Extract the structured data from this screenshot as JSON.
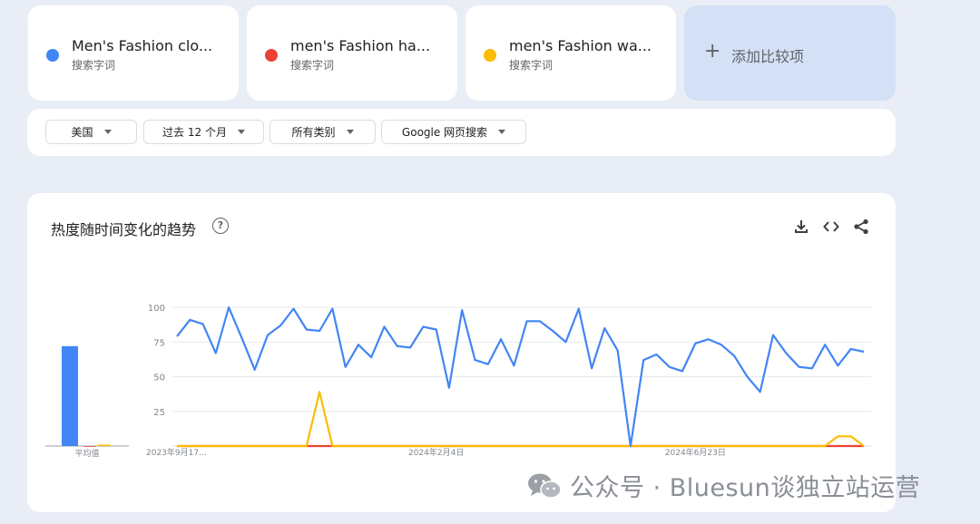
{
  "terms": [
    {
      "title": "Men's Fashion clo...",
      "subtitle": "搜索字词",
      "color": "#4285f4"
    },
    {
      "title": "men's Fashion ha...",
      "subtitle": "搜索字词",
      "color": "#ea4335"
    },
    {
      "title": "men's Fashion wa...",
      "subtitle": "搜索字词",
      "color": "#fbbc04"
    }
  ],
  "add_compare": {
    "icon": "+",
    "label": "添加比较项"
  },
  "filters": [
    {
      "label": "美国"
    },
    {
      "label": "过去 12 个月"
    },
    {
      "label": "所有类别"
    },
    {
      "label": "Google 网页搜索"
    }
  ],
  "chart_section": {
    "title": "热度随时间变化的趋势",
    "help_icon": "?",
    "tools": [
      "download-icon",
      "embed-icon",
      "share-icon"
    ]
  },
  "chart_data": {
    "type": "line",
    "ylim": [
      0,
      100
    ],
    "y_ticks": [
      100,
      75,
      50,
      25
    ],
    "x_tick_labels": [
      "2023年9月17...",
      "2024年2月4日",
      "2024年6月23日"
    ],
    "x_tick_index": [
      0,
      20,
      40
    ],
    "series": [
      {
        "name": "Men's Fashion clo...",
        "color": "#4285f4",
        "values": [
          79,
          91,
          88,
          67,
          100,
          78,
          55,
          80,
          87,
          99,
          84,
          83,
          99,
          57,
          73,
          64,
          86,
          72,
          71,
          86,
          84,
          42,
          98,
          62,
          59,
          77,
          58,
          90,
          90,
          83,
          75,
          99,
          56,
          85,
          69,
          0,
          62,
          66,
          57,
          54,
          74,
          77,
          73,
          65,
          50,
          39,
          80,
          67,
          57,
          56,
          73,
          58,
          70,
          68
        ]
      },
      {
        "name": "men's Fashion ha...",
        "color": "#ea4335",
        "values": [
          0,
          0,
          0,
          0,
          0,
          0,
          0,
          0,
          0,
          0,
          0,
          0,
          0,
          0,
          0,
          0,
          0,
          0,
          0,
          0,
          0,
          0,
          0,
          0,
          0,
          0,
          0,
          0,
          0,
          0,
          0,
          0,
          0,
          0,
          0,
          0,
          0,
          0,
          0,
          0,
          0,
          0,
          0,
          0,
          0,
          0,
          0,
          0,
          0,
          0,
          0,
          0,
          0,
          0
        ]
      },
      {
        "name": "men's Fashion wa...",
        "color": "#fbbc04",
        "values": [
          0,
          0,
          0,
          0,
          0,
          0,
          0,
          0,
          0,
          0,
          0,
          39,
          0,
          0,
          0,
          0,
          0,
          0,
          0,
          0,
          0,
          0,
          0,
          0,
          0,
          0,
          0,
          0,
          0,
          0,
          0,
          0,
          0,
          0,
          0,
          0,
          0,
          0,
          0,
          0,
          0,
          0,
          0,
          0,
          0,
          0,
          0,
          0,
          0,
          0,
          0,
          7,
          7,
          0
        ]
      }
    ],
    "average": {
      "label": "平均值",
      "values": [
        72,
        0,
        1
      ]
    },
    "grid": true
  },
  "watermark": {
    "text": "公众号 · Bluesun谈独立站运营",
    "icon": "wechat-icon"
  }
}
